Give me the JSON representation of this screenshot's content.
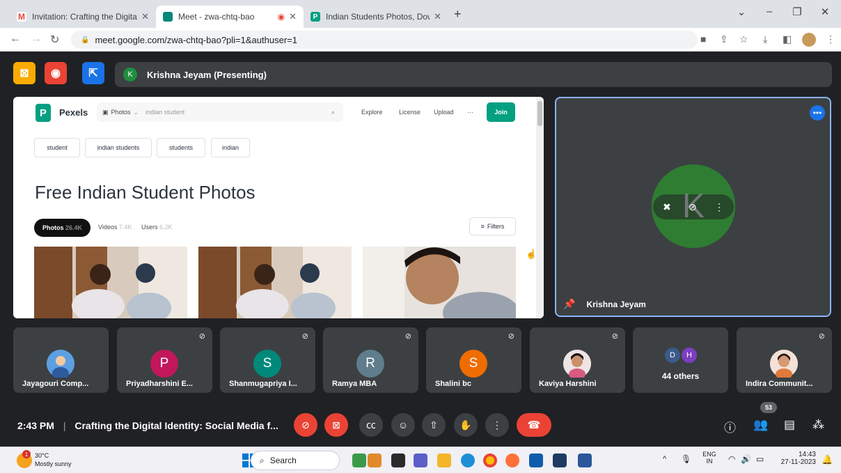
{
  "browser": {
    "tabs": [
      {
        "label": "Invitation: Crafting the Digital Id",
        "icon": "gmail-icon",
        "color": "#ea4335"
      },
      {
        "label": "Meet - zwa-chtq-bao",
        "icon": "meet-icon",
        "color": "#00897b"
      },
      {
        "label": "Indian Students Photos, Downlo",
        "icon": "pexels-icon",
        "color": "#05a081"
      }
    ],
    "new_tab": "+",
    "url": "meet.google.com/zwa-chtq-bao?pli=1&authuser=1"
  },
  "meet": {
    "presenting_label": "Krishna Jeyam (Presenting)",
    "presenter_initial": "K",
    "speaker": {
      "name": "Krishna Jeyam",
      "initial": "K"
    },
    "participants": [
      {
        "name": "Jayagouri Comp...",
        "initial": "",
        "color": "#3b7dd8",
        "photo": true
      },
      {
        "name": "Priyadharshini E...",
        "initial": "P",
        "color": "#c2185b"
      },
      {
        "name": "Shanmugapriya I...",
        "initial": "S",
        "color": "#00897b"
      },
      {
        "name": "Ramya MBA",
        "initial": "R",
        "color": "#607d8b"
      },
      {
        "name": "Shalini bc",
        "initial": "S",
        "color": "#ef6c00"
      },
      {
        "name": "Kaviya Harshini",
        "initial": "",
        "color": "#e0c7c0",
        "photo": true
      },
      {
        "name": "44 others",
        "initials": [
          "D",
          "H"
        ]
      },
      {
        "name": "Indira Communit...",
        "initial": "",
        "color": "#f0d5c9",
        "photo": true
      }
    ],
    "time": "2:43 PM",
    "meeting_title": "Crafting the Digital Identity: Social Media f...",
    "people_count": "53"
  },
  "pexels": {
    "brand": "Pexels",
    "search_type": "Photos",
    "search_query": "indian student",
    "nav": [
      "Explore",
      "License",
      "Upload",
      "···"
    ],
    "join": "Join",
    "chips": [
      "student",
      "indian students",
      "students",
      "indian"
    ],
    "title": "Free Indian Student Photos",
    "tab_photos": "Photos",
    "tab_photos_count": "26.4K",
    "tab_videos": "Videos",
    "tab_videos_count": "7.4K",
    "tab_users": "Users",
    "tab_users_count": "6.2K",
    "filters": "Filters"
  },
  "taskbar": {
    "weather_temp": "30°C",
    "weather_desc": "Mostly sunny",
    "weather_badge": "1",
    "search": "Search",
    "lang_top": "ENG",
    "lang_bottom": "IN",
    "clock_time": "14:43",
    "clock_date": "27-11-2023"
  }
}
